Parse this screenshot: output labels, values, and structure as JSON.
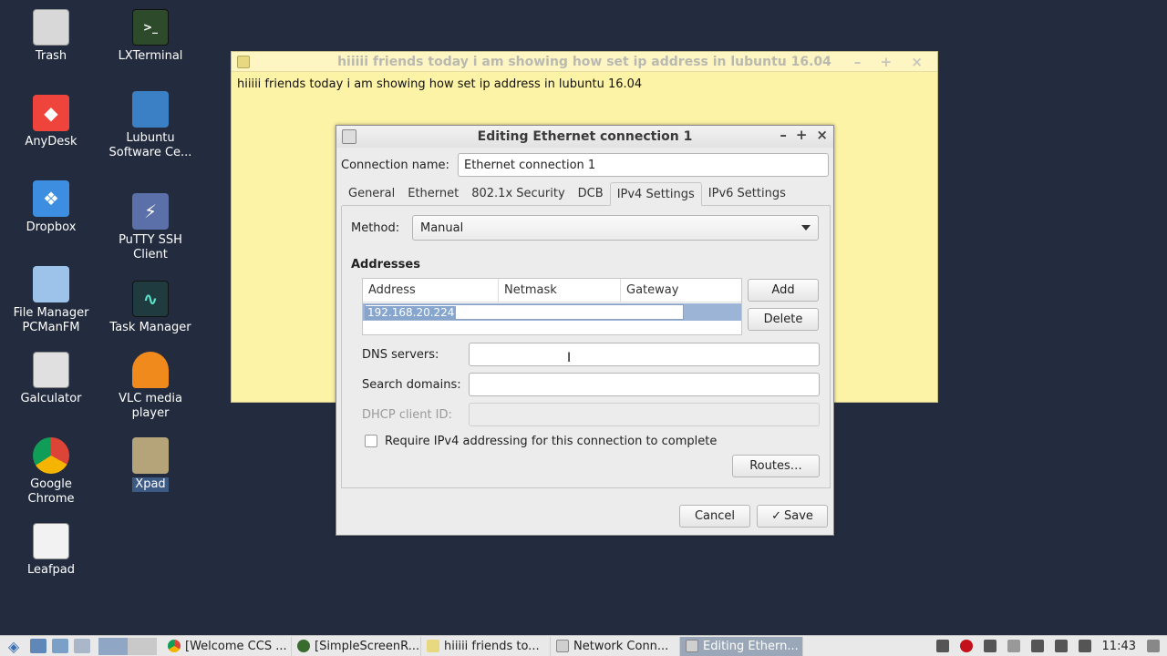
{
  "desktop": {
    "icons": [
      {
        "label": "Trash",
        "icon": "trash-icon"
      },
      {
        "label": "LXTerminal",
        "icon": "terminal-icon"
      },
      {
        "label": "AnyDesk",
        "icon": "anydesk-icon"
      },
      {
        "label": "Lubuntu Software Ce...",
        "icon": "software-center-icon"
      },
      {
        "label": "Dropbox",
        "icon": "dropbox-icon"
      },
      {
        "label": "PuTTY SSH Client",
        "icon": "putty-icon"
      },
      {
        "label": "File Manager PCManFM",
        "icon": "file-manager-icon"
      },
      {
        "label": "Task Manager",
        "icon": "task-manager-icon"
      },
      {
        "label": "Galculator",
        "icon": "calculator-icon"
      },
      {
        "label": "VLC media player",
        "icon": "vlc-icon"
      },
      {
        "label": "Google Chrome",
        "icon": "chrome-icon"
      },
      {
        "label": "Xpad",
        "icon": "xpad-icon"
      },
      {
        "label": "Leafpad",
        "icon": "leafpad-icon"
      }
    ]
  },
  "note": {
    "title": "hiiiii friends today i am showing how set ip address in lubuntu 16.04",
    "body": "hiiiii friends today i am showing how set ip address in lubuntu 16.04",
    "controls": "– + ×"
  },
  "dialog": {
    "title": "Editing Ethernet connection 1",
    "connection_name_label": "Connection name:",
    "connection_name_value": "Ethernet connection 1",
    "tabs": [
      "General",
      "Ethernet",
      "802.1x Security",
      "DCB",
      "IPv4 Settings",
      "IPv6 Settings"
    ],
    "active_tab": "IPv4 Settings",
    "method_label": "Method:",
    "method_value": "Manual",
    "addresses_heading": "Addresses",
    "address_columns": [
      "Address",
      "Netmask",
      "Gateway"
    ],
    "address_row_edit": "192.168.20.224",
    "add_label": "Add",
    "delete_label": "Delete",
    "dns_label": "DNS servers:",
    "dns_value": "",
    "search_label": "Search domains:",
    "search_value": "",
    "dhcp_label": "DHCP client ID:",
    "dhcp_value": "",
    "require_ipv4_label": "Require IPv4 addressing for this connection to complete",
    "require_ipv4_checked": false,
    "routes_label": "Routes…",
    "cancel_label": "Cancel",
    "save_label": "Save"
  },
  "taskbar": {
    "tasks": [
      {
        "label": "[Welcome CCS ...",
        "color": "#4c8bf5"
      },
      {
        "label": "[SimpleScreenR...",
        "color": "#3a6b2e"
      },
      {
        "label": "hiiiii friends to...",
        "color": "#e8d980"
      },
      {
        "label": "Network Conn...",
        "color": "#cfcfcf"
      },
      {
        "label": "Editing Ethern...",
        "color": "#cfcfcf"
      }
    ],
    "clock": "11:43"
  },
  "colors": {
    "desktop_bg": "#232c3f",
    "note_bg": "#fdf3a6",
    "selection": "#9cb5d6"
  }
}
